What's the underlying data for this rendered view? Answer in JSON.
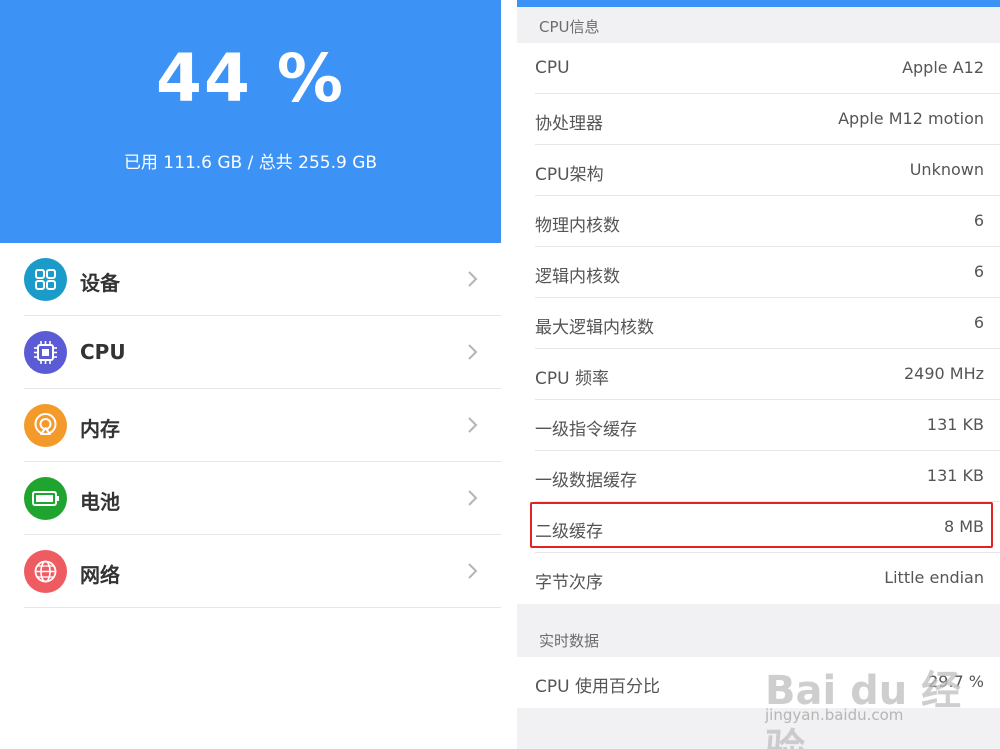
{
  "storage": {
    "percent": "44 %",
    "summary": "已用 111.6 GB / 总共 255.9 GB",
    "color": "#3d92f5"
  },
  "menu": [
    {
      "label": "设备",
      "icon": "grid-icon",
      "color": "#1a9bc9"
    },
    {
      "label": "CPU",
      "icon": "chip-icon",
      "color": "#5b5bd6"
    },
    {
      "label": "内存",
      "icon": "memory-icon",
      "color": "#f39a2b"
    },
    {
      "label": "电池",
      "icon": "battery-icon",
      "color": "#1fa52f"
    },
    {
      "label": "网络",
      "icon": "globe-icon",
      "color": "#ee5b61"
    }
  ],
  "cpu_info": {
    "header": "CPU信息",
    "rows": [
      {
        "key": "CPU",
        "value": "Apple A12"
      },
      {
        "key": "协处理器",
        "value": "Apple M12 motion"
      },
      {
        "key": "CPU架构",
        "value": "Unknown"
      },
      {
        "key": "物理内核数",
        "value": "6"
      },
      {
        "key": "逻辑内核数",
        "value": "6"
      },
      {
        "key": "最大逻辑内核数",
        "value": "6"
      },
      {
        "key": "CPU 频率",
        "value": "2490 MHz"
      },
      {
        "key": "一级指令缓存",
        "value": "131 KB"
      },
      {
        "key": "一级数据缓存",
        "value": "131 KB"
      },
      {
        "key": "二级缓存",
        "value": "8 MB"
      },
      {
        "key": "字节次序",
        "value": "Little endian"
      }
    ]
  },
  "realtime": {
    "header": "实时数据",
    "rows": [
      {
        "key": "CPU 使用百分比",
        "value": "29.7 %"
      }
    ]
  },
  "highlight_color": "#e02424",
  "watermark": {
    "brand": "Bai du 经验",
    "url": "jingyan.baidu.com"
  }
}
